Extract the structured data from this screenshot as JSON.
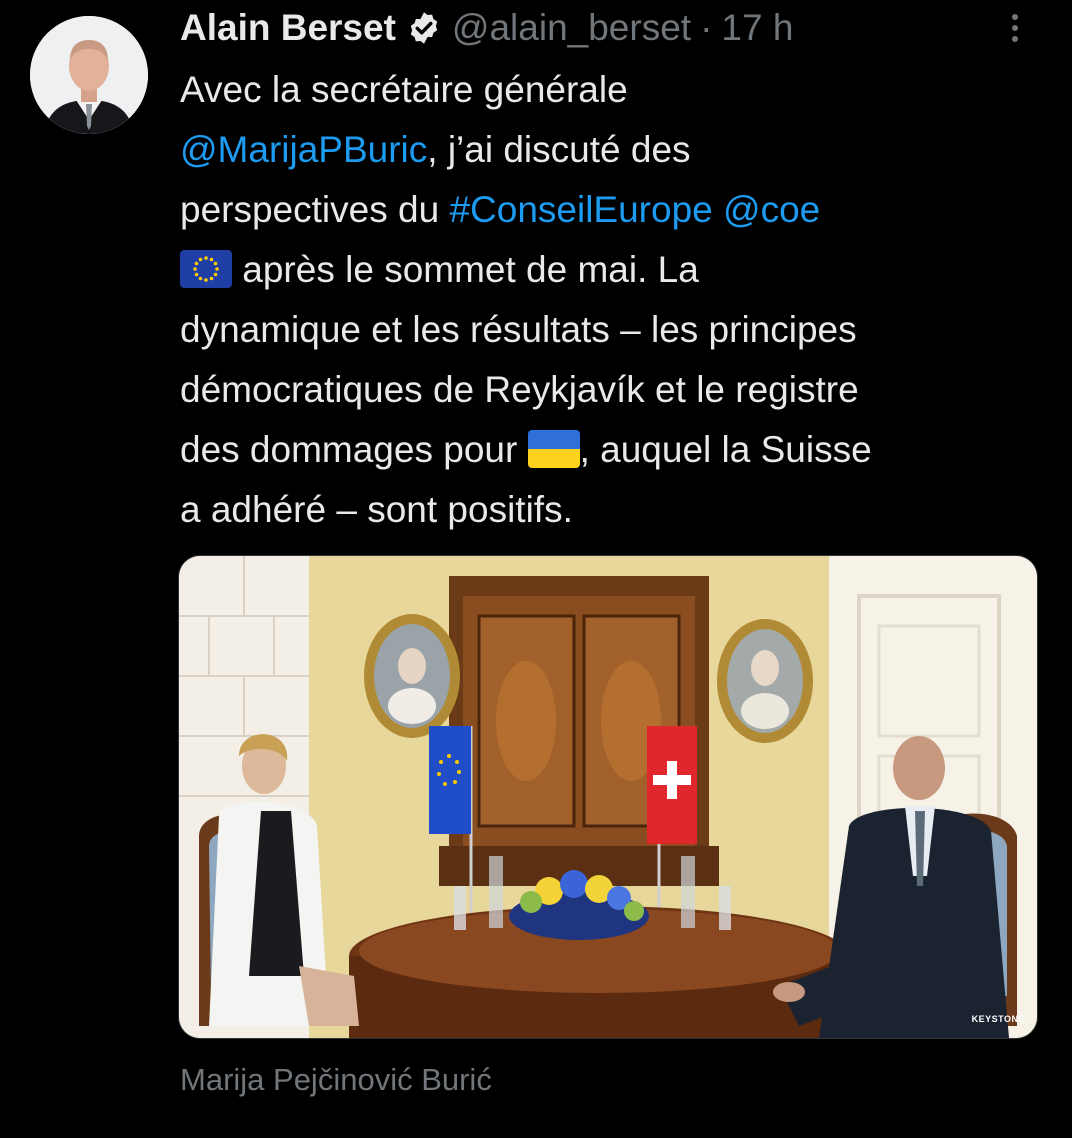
{
  "tweet": {
    "author_name": "Alain Berset",
    "handle": "@alain_berset",
    "separator": "·",
    "timestamp": "17 h",
    "text": {
      "l1": "Avec la secrétaire générale",
      "l2_mention": "@MarijaPBuric",
      "l2_rest": ", j’ai discuté des",
      "l3_a": "perspectives du ",
      "l3_hashtag": "#ConseilEurope",
      "l3_space": " ",
      "l3_mention": "@coe",
      "l4_rest": " après le sommet de mai. La",
      "l5": "dynamique et les résultats – les principes",
      "l6": "démocratiques de Reykjavík et le registre",
      "l7_a": "des dommages pour ",
      "l7_b": ", auquel la Suisse",
      "l8": "a adhéré – sont positifs."
    },
    "media": {
      "credit": "KEYSTONE"
    },
    "caption": "Marija Pejčinović Burić"
  },
  "colors": {
    "background": "#000000",
    "text": "#e7e9ea",
    "secondary": "#71767b",
    "link": "#1d9bf0"
  },
  "icons": {
    "verified": "verified-badge-icon",
    "more": "more-options-icon",
    "eu_flag": "eu-flag-emoji-icon",
    "ukraine_flag": "ukraine-flag-emoji-icon"
  }
}
